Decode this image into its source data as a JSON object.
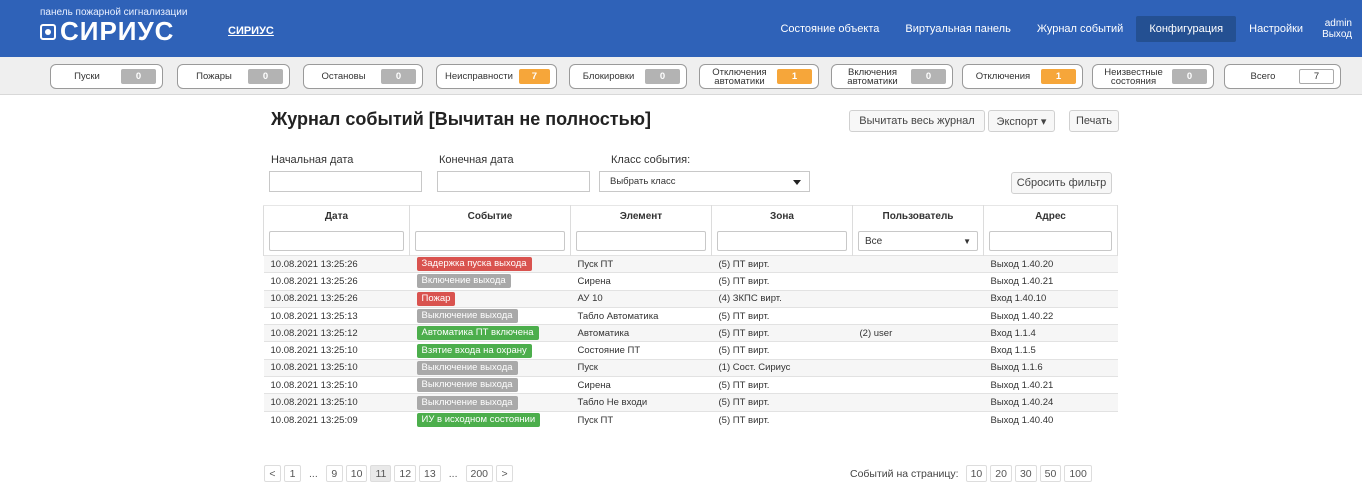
{
  "header": {
    "brand_subtitle": "панель пожарной сигнализации",
    "brand_name": "СИРИУС",
    "app_name": "СИРИУС",
    "nav": [
      {
        "label": "Состояние объекта",
        "active": false
      },
      {
        "label": "Виртуальная панель",
        "active": false
      },
      {
        "label": "Журнал событий",
        "active": false
      },
      {
        "label": "Конфигурация",
        "active": true
      },
      {
        "label": "Настройки",
        "active": false
      }
    ],
    "user": {
      "name": "admin",
      "logout": "Выход"
    }
  },
  "counters": [
    {
      "label": "Пуски",
      "value": "0",
      "color": "gray"
    },
    {
      "label": "Пожары",
      "value": "0",
      "color": "gray"
    },
    {
      "label": "Остановы",
      "value": "0",
      "color": "gray"
    },
    {
      "label": "Неисправности",
      "value": "7",
      "color": "orange"
    },
    {
      "label": "Блокировки",
      "value": "0",
      "color": "gray"
    },
    {
      "label": "Отключения автоматики",
      "value": "1",
      "color": "orange"
    },
    {
      "label": "Включения автоматики",
      "value": "0",
      "color": "gray"
    },
    {
      "label": "Отключения",
      "value": "1",
      "color": "orange"
    },
    {
      "label": "Неизвестные состояния",
      "value": "0",
      "color": "gray"
    },
    {
      "label": "Всего",
      "value": "7",
      "color": "white"
    }
  ],
  "journal": {
    "title": "Журнал событий [Вычитан не полностью]",
    "read_all_button": "Вычитать весь журнал",
    "export_button": "Экспорт ▾",
    "print_button": "Печать",
    "filters": {
      "start_date_label": "Начальная дата",
      "end_date_label": "Конечная дата",
      "class_label": "Класс события:",
      "class_value": "Выбрать класс",
      "reset_button": "Сбросить фильтр"
    },
    "columns": [
      "Дата",
      "Событие",
      "Элемент",
      "Зона",
      "Пользователь",
      "Адрес"
    ],
    "user_filter_value": "Все",
    "rows": [
      {
        "date": "10.08.2021   13:25:26",
        "event": "Задержка пуска выхода",
        "event_color": "red",
        "element": "Пуск ПТ",
        "zone": "(5) ПТ вирт.",
        "user": "",
        "address": "Выход 1.40.20"
      },
      {
        "date": "10.08.2021   13:25:26",
        "event": "Включение выхода",
        "event_color": "gray",
        "element": "Сирена",
        "zone": "(5) ПТ вирт.",
        "user": "",
        "address": "Выход 1.40.21"
      },
      {
        "date": "10.08.2021   13:25:26",
        "event": "Пожар",
        "event_color": "red",
        "element": "АУ 10",
        "zone": "(4) ЗКПС вирт.",
        "user": "",
        "address": "Вход 1.40.10"
      },
      {
        "date": "10.08.2021   13:25:13",
        "event": "Выключение выхода",
        "event_color": "gray",
        "element": "Табло Автоматика",
        "zone": "(5) ПТ вирт.",
        "user": "",
        "address": "Выход 1.40.22"
      },
      {
        "date": "10.08.2021   13:25:12",
        "event": "Автоматика ПТ включена",
        "event_color": "green",
        "element": "Автоматика",
        "zone": "(5) ПТ вирт.",
        "user": "(2) user",
        "address": "Вход 1.1.4"
      },
      {
        "date": "10.08.2021   13:25:10",
        "event": "Взятие входа на охрану",
        "event_color": "green",
        "element": "Состояние ПТ",
        "zone": "(5) ПТ вирт.",
        "user": "",
        "address": "Вход 1.1.5"
      },
      {
        "date": "10.08.2021   13:25:10",
        "event": "Выключение выхода",
        "event_color": "gray",
        "element": "Пуск",
        "zone": "(1) Сост. Сириус",
        "user": "",
        "address": "Выход 1.1.6"
      },
      {
        "date": "10.08.2021   13:25:10",
        "event": "Выключение выхода",
        "event_color": "gray",
        "element": "Сирена",
        "zone": "(5) ПТ вирт.",
        "user": "",
        "address": "Выход 1.40.21"
      },
      {
        "date": "10.08.2021   13:25:10",
        "event": "Выключение выхода",
        "event_color": "gray",
        "element": "Табло Не входи",
        "zone": "(5) ПТ вирт.",
        "user": "",
        "address": "Выход 1.40.24"
      },
      {
        "date": "10.08.2021   13:25:09",
        "event": "ИУ в исходном состоянии",
        "event_color": "green",
        "element": "Пуск ПТ",
        "zone": "(5) ПТ вирт.",
        "user": "",
        "address": "Выход 1.40.40"
      }
    ]
  },
  "pagination": {
    "pages": [
      "<",
      "1",
      "...",
      "9",
      "10",
      "11",
      "12",
      "13",
      "...",
      "200",
      ">"
    ],
    "active_page": "11",
    "per_page_label": "Событий на страницу:",
    "per_page_options": [
      "10",
      "20",
      "30",
      "50",
      "100"
    ]
  },
  "colors": {
    "header_bg": "#2f62b8",
    "nav_active_bg": "#245092",
    "badge_orange": "#f6a63a",
    "badge_gray": "#b3b3b3",
    "event_red": "#d9534f",
    "event_gray": "#a9a9a9",
    "event_green": "#4cae4c"
  }
}
